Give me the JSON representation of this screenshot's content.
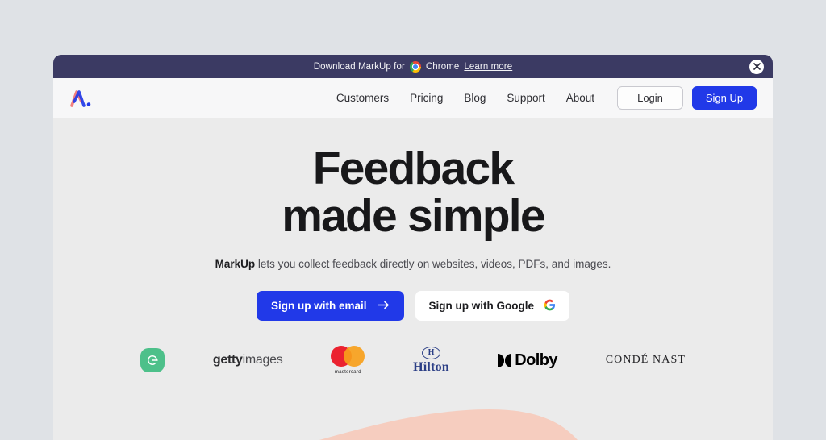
{
  "banner": {
    "text_before": "Download MarkUp for",
    "chrome_icon": "chrome-icon",
    "chrome_label": "Chrome",
    "learn_more": "Learn more",
    "close_icon": "close-icon",
    "background": "#3b3a63"
  },
  "nav": {
    "logo_name": "markup-logo",
    "links": [
      {
        "label": "Customers"
      },
      {
        "label": "Pricing"
      },
      {
        "label": "Blog"
      },
      {
        "label": "Support"
      },
      {
        "label": "About"
      }
    ],
    "login_label": "Login",
    "signup_label": "Sign Up",
    "accent_color": "#2139e8"
  },
  "hero": {
    "title_line1": "Feedback",
    "title_line2": "made simple",
    "subtitle_brand": "MarkUp",
    "subtitle_rest": " lets you collect feedback directly on websites, videos, PDFs, and images.",
    "cta_email_label": "Sign up with email",
    "cta_email_icon": "arrow-right-icon",
    "cta_google_label": "Sign up with Google",
    "cta_google_icon": "google-icon",
    "background": "#ebebeb"
  },
  "clients": [
    {
      "name": "godaddy",
      "label": "",
      "color": "#4dc08a"
    },
    {
      "name": "gettyimages",
      "bold_part": "getty",
      "light_part": "images"
    },
    {
      "name": "mastercard",
      "label": "mastercard",
      "color_left": "#eb2230",
      "color_right": "#f79f1b"
    },
    {
      "name": "hilton",
      "emblem": "H",
      "label": "Hilton",
      "color": "#2c3f86"
    },
    {
      "name": "dolby",
      "label": "Dolby",
      "color": "#000000"
    },
    {
      "name": "conde-nast",
      "label": "CONDÉ NAST"
    }
  ],
  "decor": {
    "blob_name": "pink-blob-decoration",
    "blob_color": "#f6cdbf"
  }
}
